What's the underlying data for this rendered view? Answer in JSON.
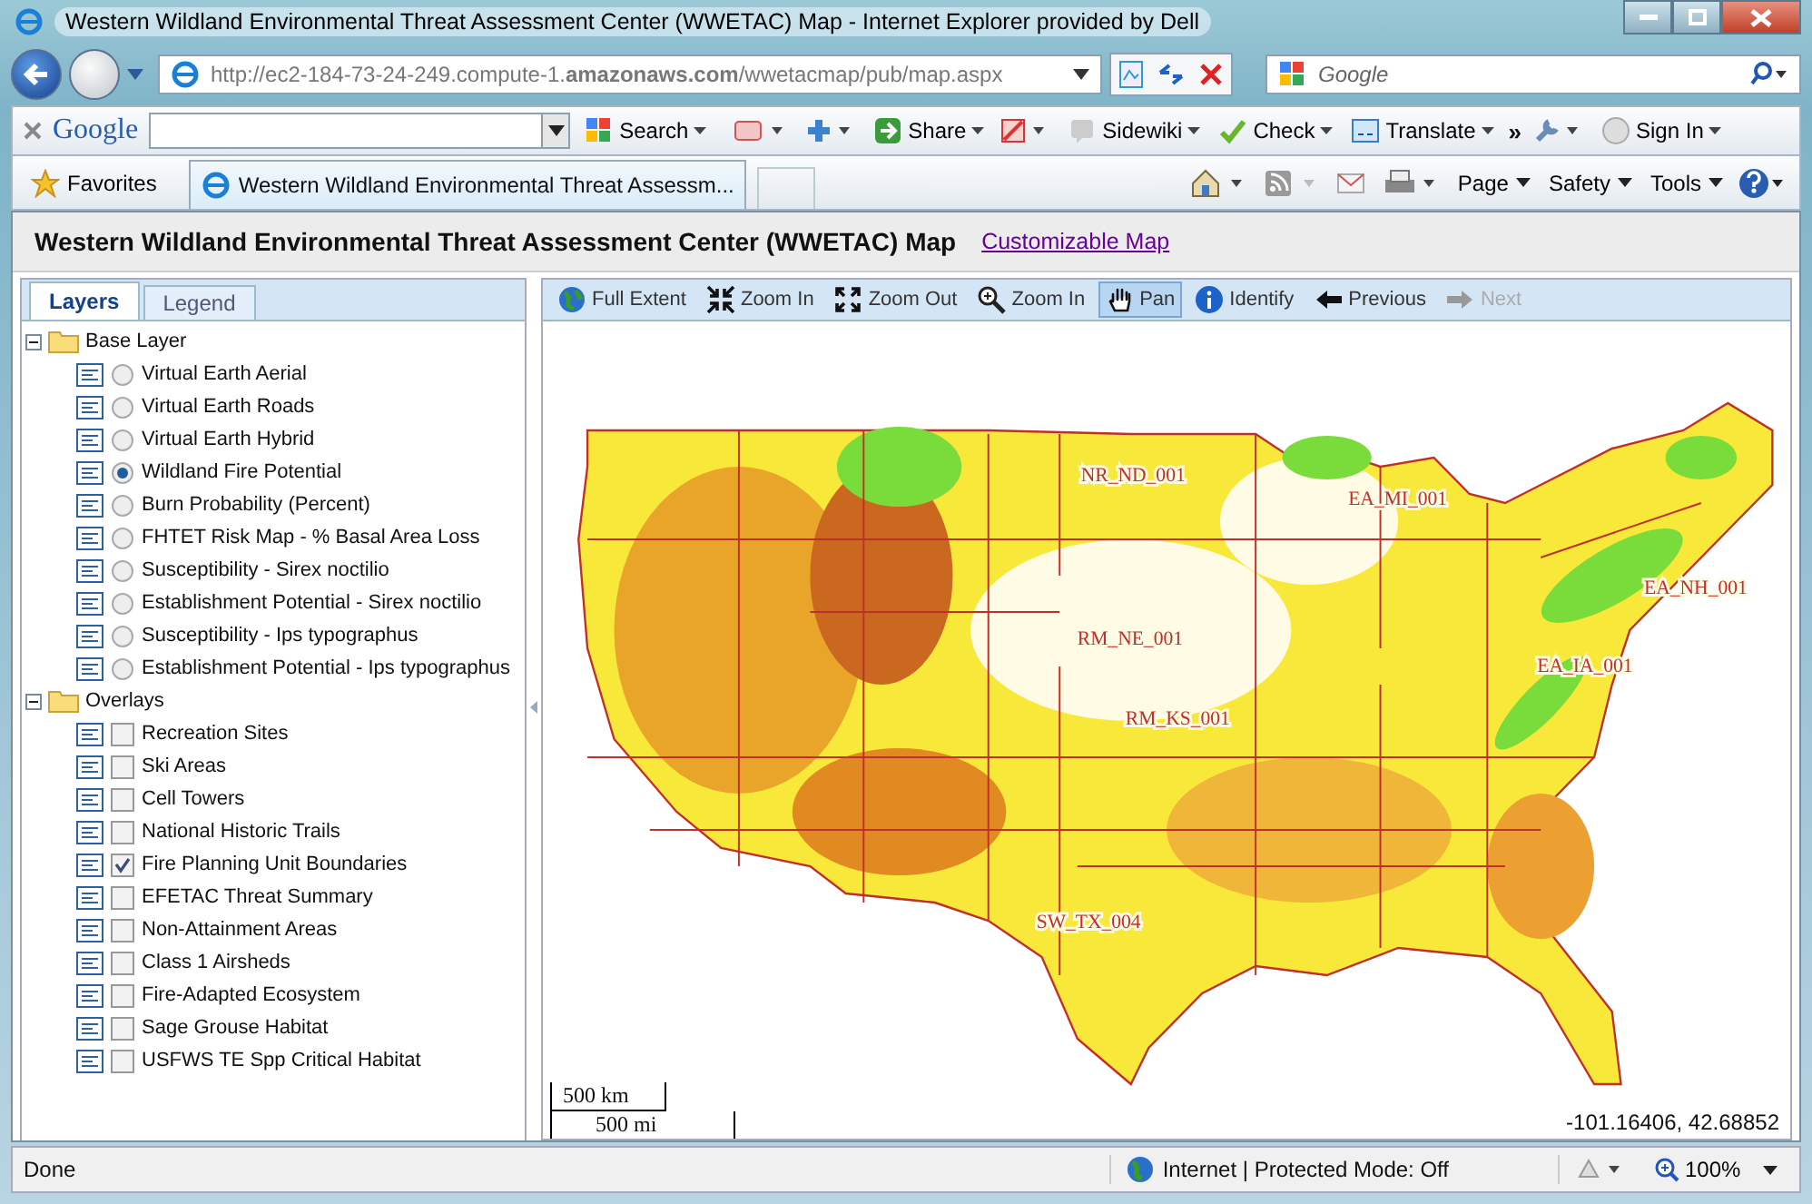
{
  "window": {
    "title": "Western Wildland Environmental Threat Assessment Center (WWETAC) Map - Internet Explorer provided by Dell"
  },
  "address_bar": {
    "url": "http://ec2-184-73-24-249.compute-1.**amazonaws.com**/wwetacmap/pub/map.aspx",
    "search_placeholder": "Google"
  },
  "google_toolbar": {
    "logo": "Google",
    "items": [
      {
        "label": "Search",
        "kind": "search"
      },
      {
        "label": "Share",
        "kind": "share"
      },
      {
        "label": "Sidewiki",
        "kind": "sidewiki"
      },
      {
        "label": "Check",
        "kind": "check"
      },
      {
        "label": "Translate",
        "kind": "translate"
      },
      {
        "label": "Sign In",
        "kind": "signin"
      }
    ],
    "more": "»"
  },
  "favorites_bar": {
    "favorites": "Favorites",
    "tab": "Western Wildland Environmental Threat Assessm...",
    "commands": [
      "Page",
      "Safety",
      "Tools"
    ]
  },
  "page": {
    "title": "Western Wildland Environmental Threat Assessment Center (WWETAC) Map",
    "link": "Customizable Map"
  },
  "panel_tabs": [
    {
      "label": "Layers",
      "selected": true
    },
    {
      "label": "Legend",
      "selected": false
    }
  ],
  "tree": [
    {
      "label": "Base Layer",
      "expanded": true,
      "kind": "radio",
      "children": [
        {
          "label": "Virtual Earth Aerial",
          "selected": false
        },
        {
          "label": "Virtual Earth Roads",
          "selected": false
        },
        {
          "label": "Virtual Earth Hybrid",
          "selected": false
        },
        {
          "label": "Wildland Fire Potential",
          "selected": true
        },
        {
          "label": "Burn Probability (Percent)",
          "selected": false
        },
        {
          "label": "FHTET Risk Map - % Basal Area Loss",
          "selected": false
        },
        {
          "label": "Susceptibility - Sirex noctilio",
          "selected": false
        },
        {
          "label": "Establishment Potential - Sirex noctilio",
          "selected": false
        },
        {
          "label": "Susceptibility - Ips typographus",
          "selected": false
        },
        {
          "label": "Establishment Potential - Ips typographus",
          "selected": false
        }
      ]
    },
    {
      "label": "Overlays",
      "expanded": true,
      "kind": "checkbox",
      "children": [
        {
          "label": "Recreation Sites",
          "checked": false
        },
        {
          "label": "Ski Areas",
          "checked": false
        },
        {
          "label": "Cell Towers",
          "checked": false
        },
        {
          "label": "National Historic Trails",
          "checked": false
        },
        {
          "label": "Fire Planning Unit Boundaries",
          "checked": true
        },
        {
          "label": "EFETAC Threat Summary",
          "checked": false
        },
        {
          "label": "Non-Attainment Areas",
          "checked": false
        },
        {
          "label": "Class 1 Airsheds",
          "checked": false
        },
        {
          "label": "Fire-Adapted Ecosystem",
          "checked": false
        },
        {
          "label": "Sage Grouse Habitat",
          "checked": false
        },
        {
          "label": "USFWS TE Spp Critical Habitat",
          "checked": false
        }
      ]
    }
  ],
  "map_toolbar": [
    {
      "label": "Full Extent",
      "kind": "globe",
      "selected": false,
      "disabled": false
    },
    {
      "label": "Zoom In",
      "kind": "contract",
      "selected": false,
      "disabled": false
    },
    {
      "label": "Zoom Out",
      "kind": "expand",
      "selected": false,
      "disabled": false
    },
    {
      "label": "Zoom In",
      "kind": "magnifier",
      "selected": false,
      "disabled": false
    },
    {
      "label": "Pan",
      "kind": "hand",
      "selected": true,
      "disabled": false
    },
    {
      "label": "Identify",
      "kind": "info",
      "selected": false,
      "disabled": false
    },
    {
      "label": "Previous",
      "kind": "back",
      "selected": false,
      "disabled": false
    },
    {
      "label": "Next",
      "kind": "forward",
      "selected": false,
      "disabled": true
    }
  ],
  "map": {
    "unit_labels": [
      "NR_ND_001",
      "EA_MI_001",
      "EA_NH_001",
      "RM_NE_001",
      "EA_IA_001",
      "RM_KS_001",
      "SW_TX_004"
    ],
    "scale": [
      "500 km",
      "500 mi"
    ],
    "coordinates": "-101.16406, 42.68852"
  },
  "status_bar": {
    "status": "Done",
    "zone": "Internet | Protected Mode: Off",
    "zoom": "100%"
  }
}
